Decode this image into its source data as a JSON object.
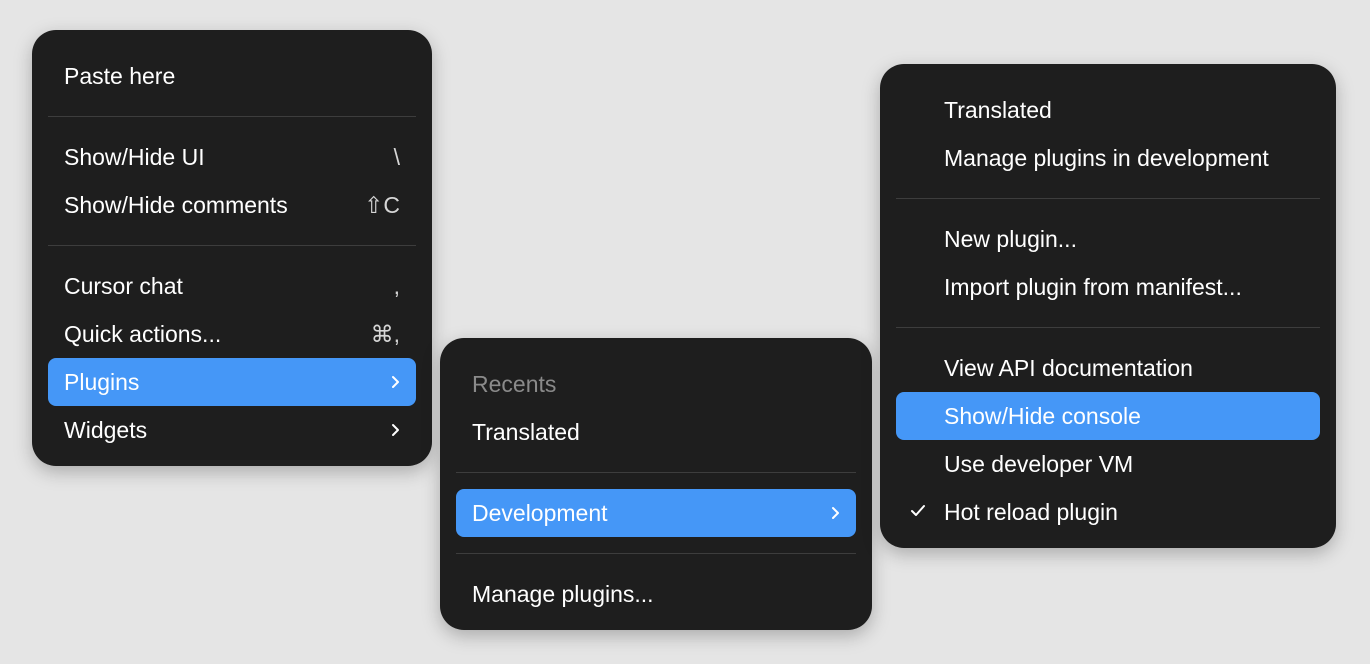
{
  "main_menu": {
    "paste_here": "Paste here",
    "show_hide_ui": {
      "label": "Show/Hide UI",
      "shortcut": "\\"
    },
    "show_hide_comments": {
      "label": "Show/Hide comments",
      "shortcut": "⇧C"
    },
    "cursor_chat": {
      "label": "Cursor chat",
      "shortcut": ","
    },
    "quick_actions": {
      "label": "Quick actions...",
      "shortcut": "⌘,"
    },
    "plugins": {
      "label": "Plugins"
    },
    "widgets": {
      "label": "Widgets"
    }
  },
  "plugins_menu": {
    "recents_header": "Recents",
    "translated": "Translated",
    "development": "Development",
    "manage_plugins": "Manage plugins..."
  },
  "development_menu": {
    "translated": "Translated",
    "manage_in_development": "Manage plugins in development",
    "new_plugin": "New plugin...",
    "import_plugin": "Import plugin from manifest...",
    "view_api_docs": "View API documentation",
    "show_hide_console": "Show/Hide console",
    "use_developer_vm": "Use developer VM",
    "hot_reload": "Hot reload plugin"
  },
  "colors": {
    "menu_background": "#1e1e1e",
    "highlight": "#4597f7",
    "page_background": "#e5e5e5"
  },
  "icons": {
    "submenu": "chevron-right-icon",
    "checked": "checkmark-icon"
  }
}
